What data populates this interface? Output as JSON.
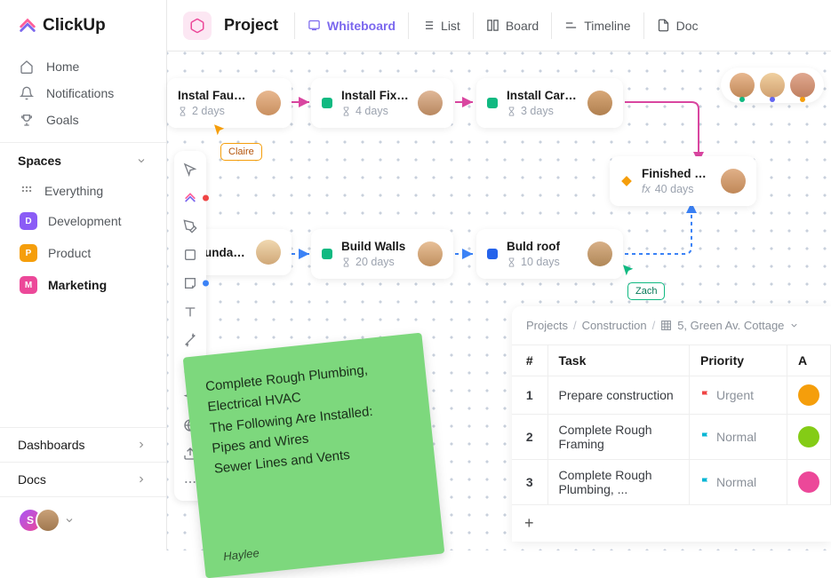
{
  "logo": {
    "text": "ClickUp"
  },
  "nav": {
    "home": "Home",
    "notifications": "Notifications",
    "goals": "Goals"
  },
  "spaces": {
    "header": "Spaces",
    "everything": "Everything",
    "items": [
      {
        "initial": "D",
        "label": "Development",
        "color": "#8b5cf6"
      },
      {
        "initial": "P",
        "label": "Product",
        "color": "#f59e0b"
      },
      {
        "initial": "M",
        "label": "Marketing",
        "color": "#ec4899",
        "active": true
      }
    ]
  },
  "bottom_nav": {
    "dashboards": "Dashboards",
    "docs": "Docs"
  },
  "avatar_badge": "S",
  "project": {
    "title": "Project",
    "views": {
      "whiteboard": "Whiteboard",
      "list": "List",
      "board": "Board",
      "timeline": "Timeline",
      "doc": "Doc"
    }
  },
  "cards": {
    "faucets": {
      "title": "Instal Faucets",
      "meta": "2 days",
      "color": "#10b981"
    },
    "fixtures": {
      "title": "Install Fixstu...",
      "meta": "4 days",
      "color": "#10b981"
    },
    "carpet": {
      "title": "Install Carpetin...",
      "meta": "3 days",
      "color": "#10b981"
    },
    "finished": {
      "title": "Finished house",
      "meta": "40 days",
      "diamond": "#f59e0b"
    },
    "foundation": {
      "title": "undati...",
      "meta": "",
      "color": "#2563eb"
    },
    "walls": {
      "title": "Build Walls",
      "meta": "20 days",
      "color": "#10b981"
    },
    "roof": {
      "title": "Buld roof",
      "meta": "10 days",
      "color": "#2563eb"
    }
  },
  "cursors": {
    "claire": "Claire",
    "zach": "Zach",
    "haylee": "Haylee"
  },
  "sticky": {
    "line1": "Complete Rough Plumbing, Electrical HVAC",
    "line2": "The Following Are Installed:",
    "line3": "Pipes and Wires",
    "line4": "Sewer Lines and Vents",
    "signature": "Haylee"
  },
  "table": {
    "breadcrumb": {
      "projects": "Projects",
      "construction": "Construction",
      "address": "5, Green Av. Cottage"
    },
    "headers": {
      "num": "#",
      "task": "Task",
      "priority": "Priority",
      "assignee": "A"
    },
    "rows": [
      {
        "num": "1",
        "task": "Prepare construction",
        "priority": "Urgent",
        "flag": "#ef4444",
        "av": "#f59e0b"
      },
      {
        "num": "2",
        "task": "Complete Rough Framing",
        "priority": "Normal",
        "flag": "#06b6d4",
        "av": "#84cc16"
      },
      {
        "num": "3",
        "task": "Complete Rough Plumbing, ...",
        "priority": "Normal",
        "flag": "#06b6d4",
        "av": "#ec4899"
      }
    ]
  }
}
